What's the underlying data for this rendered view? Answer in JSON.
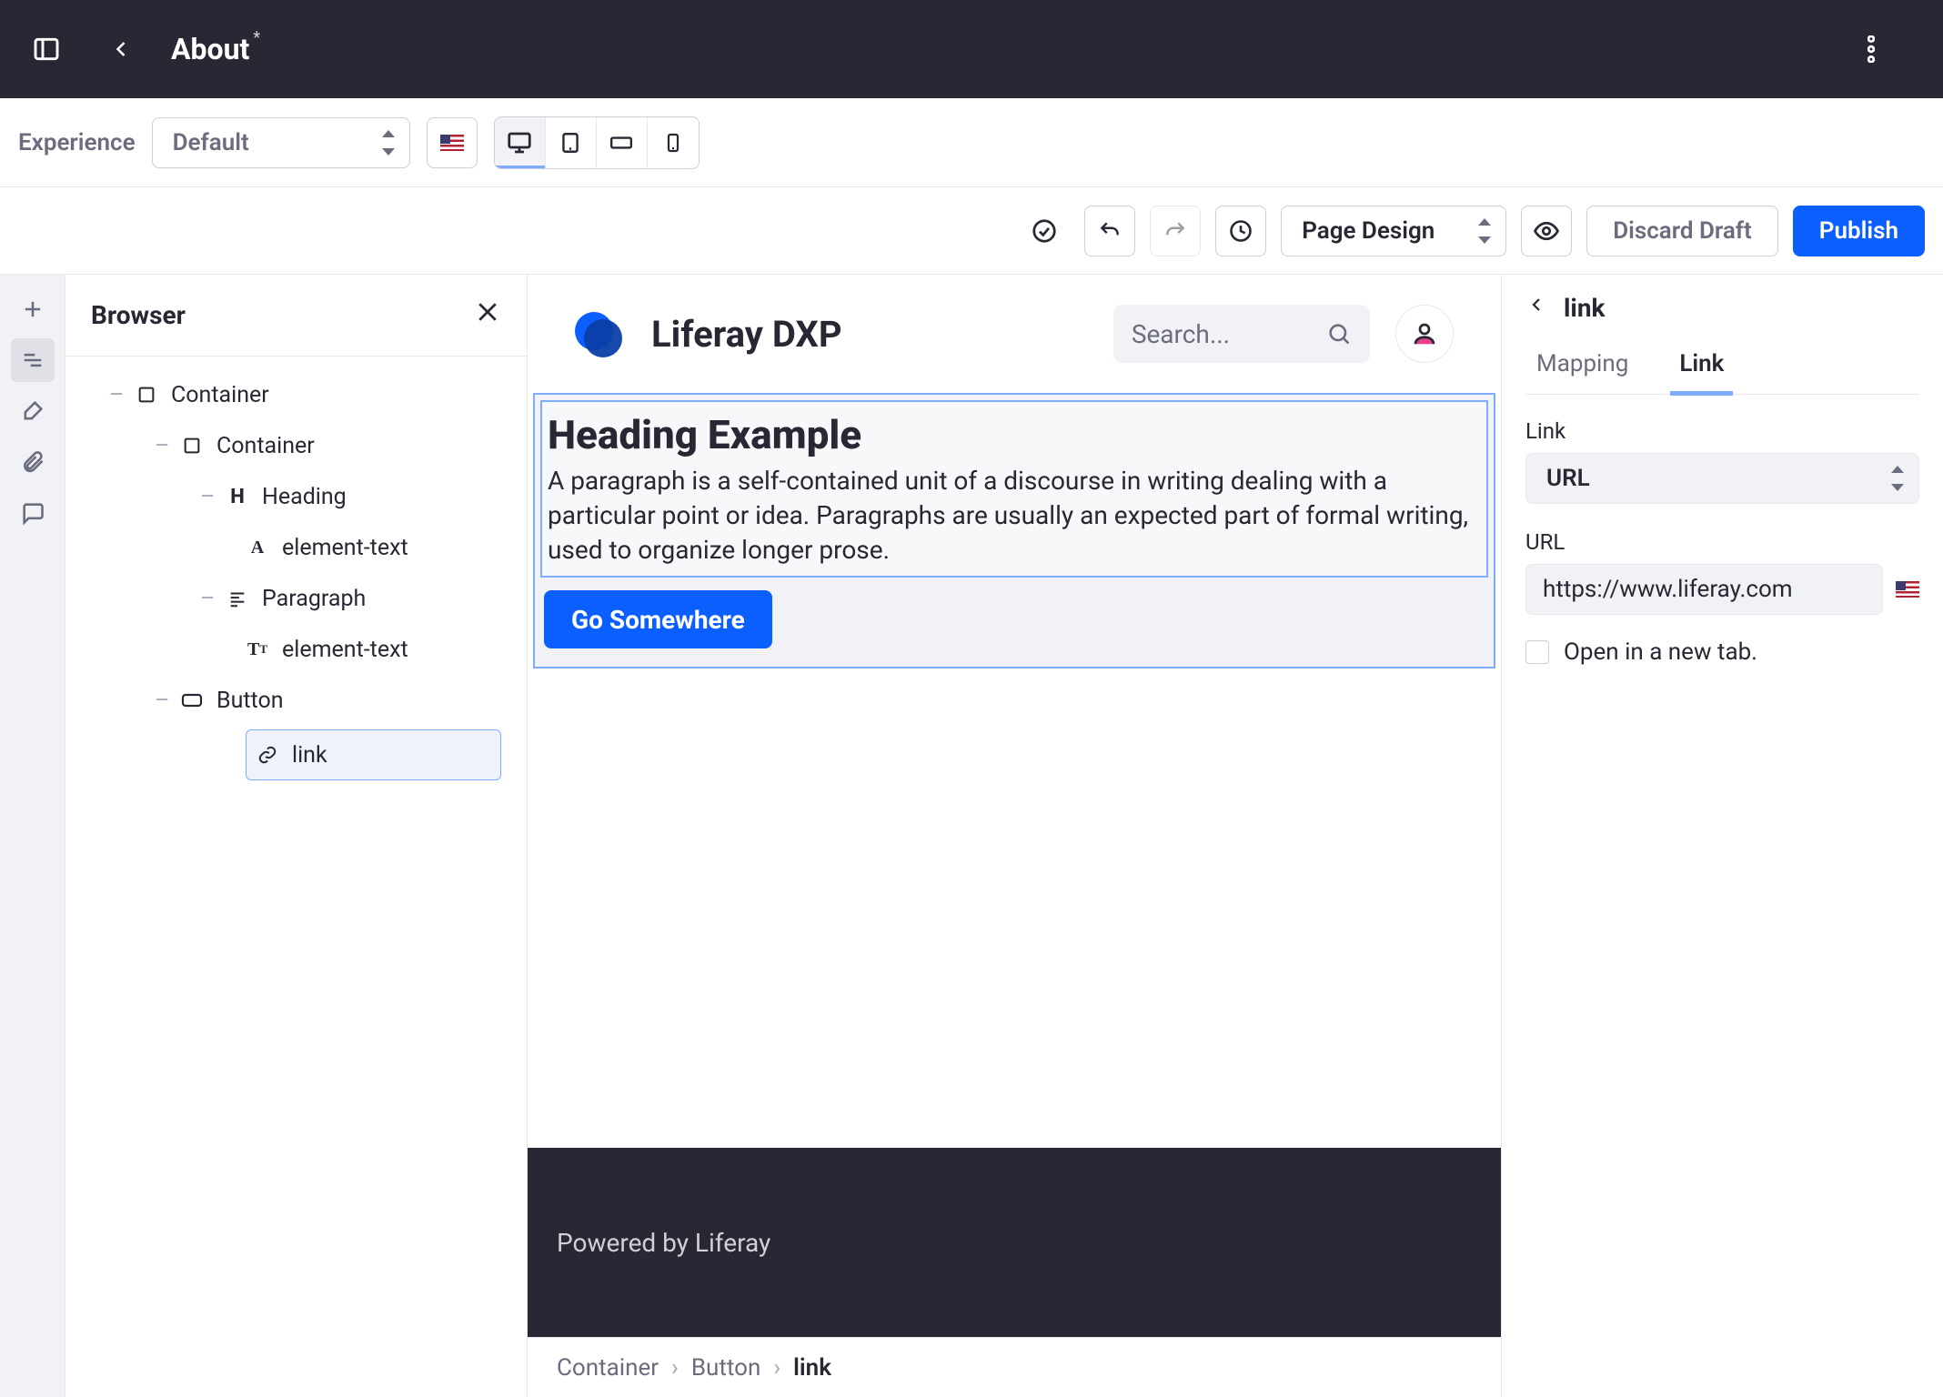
{
  "header": {
    "title": "About",
    "modified_marker": "*"
  },
  "experience": {
    "label": "Experience",
    "selected": "Default"
  },
  "toolbar": {
    "mode_selected": "Page Design",
    "discard": "Discard Draft",
    "publish": "Publish"
  },
  "browser_panel": {
    "title": "Browser"
  },
  "tree": {
    "container1": "Container",
    "container2": "Container",
    "heading": "Heading",
    "heading_text": "element-text",
    "paragraph": "Paragraph",
    "paragraph_text": "element-text",
    "button": "Button",
    "link": "link"
  },
  "preview": {
    "brand": "Liferay DXP",
    "search_placeholder": "Search...",
    "heading": "Heading Example",
    "paragraph": "A paragraph is a self-contained unit of a discourse in writing dealing with a particular point or idea. Paragraphs are usually an expected part of formal writing, used to organize longer prose.",
    "button": "Go Somewhere",
    "footer": "Powered by Liferay"
  },
  "breadcrumb": {
    "a": "Container",
    "b": "Button",
    "c": "link"
  },
  "right_panel": {
    "title": "link",
    "tabs": {
      "mapping": "Mapping",
      "link": "Link"
    },
    "link_label": "Link",
    "link_type": "URL",
    "url_label": "URL",
    "url_value": "https://www.liferay.com",
    "new_tab": "Open in a new tab."
  }
}
